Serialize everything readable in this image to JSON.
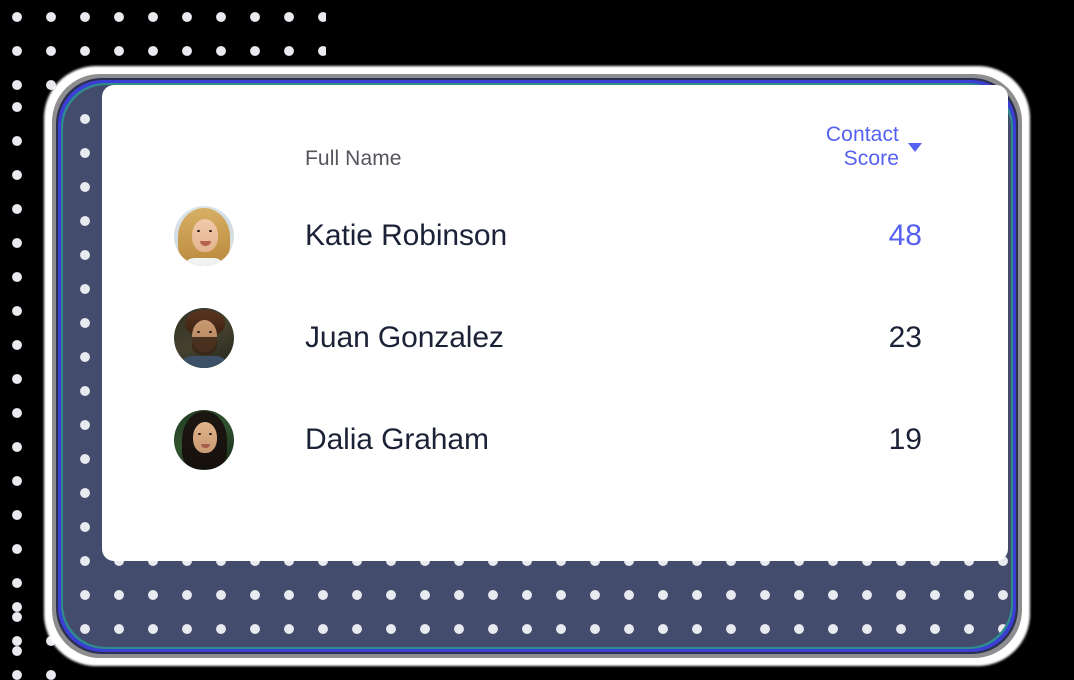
{
  "table": {
    "columns": [
      {
        "key": "full_name",
        "label": "Full Name",
        "sortable": false,
        "accent": false
      },
      {
        "key": "contact_score",
        "label": "Contact Score",
        "sortable": true,
        "accent": true,
        "sort_icon": "caret-down-icon",
        "sort_direction": "desc"
      }
    ],
    "rows": [
      {
        "avatar": "avatar-katie-robinson",
        "name": "Katie Robinson",
        "score": "48",
        "score_accent": true
      },
      {
        "avatar": "avatar-juan-gonzalez",
        "name": "Juan Gonzalez",
        "score": "23",
        "score_accent": false
      },
      {
        "avatar": "avatar-dalia-graham",
        "name": "Dalia Graham",
        "score": "19",
        "score_accent": false
      }
    ]
  },
  "theme": {
    "accent_blue": "#5561f0",
    "text_dark": "#1b2237",
    "header_gray": "#54565e",
    "card_navy": "#434c6c",
    "ring_blue": "#3b3fd4",
    "ring_teal": "#2e8c8c",
    "ring_gray": "#8e8e90",
    "dot_color": "#e9eaf0",
    "card_white": "#ffffff",
    "background": "#000000"
  }
}
